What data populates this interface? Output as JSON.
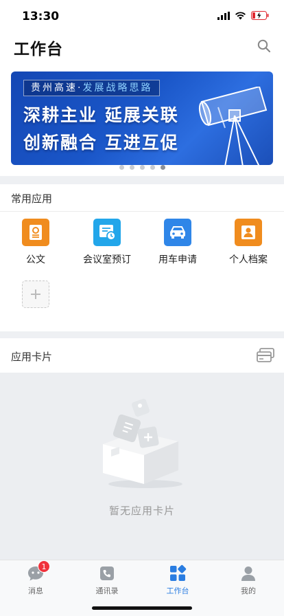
{
  "status_bar": {
    "time": "13:30"
  },
  "header": {
    "title": "工作台",
    "search_icon": "search-icon"
  },
  "banner": {
    "tag_prefix": "贵州高速·",
    "tag_accent": "发展战略思路",
    "line1": "深耕主业  延展关联",
    "line2": "创新融合  互进互促",
    "dots_count": 5,
    "active_dot": 5
  },
  "common_apps": {
    "title": "常用应用",
    "items": [
      {
        "label": "公文",
        "icon": "document-icon",
        "color": "#f08c1e"
      },
      {
        "label": "会议室预订",
        "icon": "meeting-room-icon",
        "color": "#22a6ea"
      },
      {
        "label": "用车申请",
        "icon": "car-icon",
        "color": "#2f86e8"
      },
      {
        "label": "个人档案",
        "icon": "profile-icon",
        "color": "#f08c1e"
      }
    ],
    "add_icon": "plus-icon"
  },
  "app_cards": {
    "title": "应用卡片",
    "icon": "card-stack-icon",
    "empty_text": "暂无应用卡片"
  },
  "tab_bar": {
    "items": [
      {
        "label": "消息",
        "icon": "message-icon",
        "badge": "1"
      },
      {
        "label": "通讯录",
        "icon": "contacts-icon"
      },
      {
        "label": "工作台",
        "icon": "workbench-icon",
        "active": true
      },
      {
        "label": "我的",
        "icon": "user-icon"
      }
    ],
    "accent_color": "#2a7de1"
  }
}
